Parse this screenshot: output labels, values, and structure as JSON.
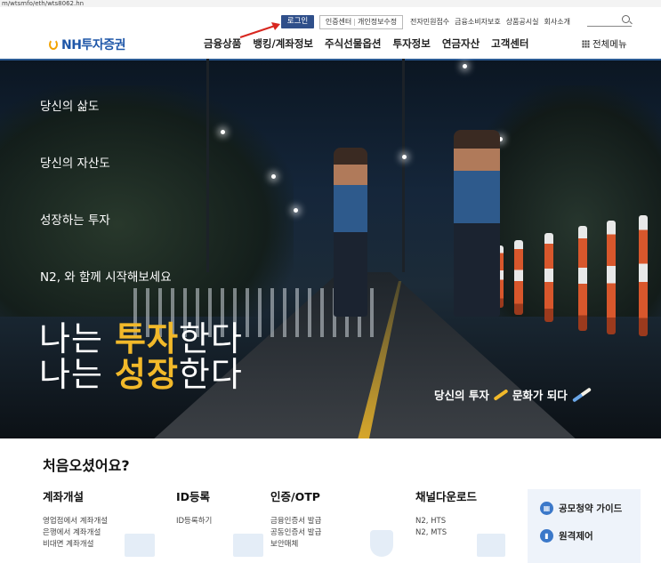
{
  "browser": {
    "url_fragment": "m/wtsmfo/eth/wts8062.hn"
  },
  "utility": {
    "login": "로그인",
    "cert_center": "인증센터",
    "edit_info": "개인정보수정",
    "links": [
      "전자민원접수",
      "금융소비자보호",
      "상품공시실",
      "회사소개"
    ]
  },
  "brand": {
    "logo": "NH투자증권",
    "accent": "#f2b92a",
    "navy": "#1e56a8"
  },
  "gnb": [
    "금융상품",
    "뱅킹/계좌정보",
    "주식선물옵션",
    "투자정보",
    "연금자산",
    "고객센터"
  ],
  "all_menu": "전체메뉴",
  "hero": {
    "line1": "당신의 삶도",
    "line2": "당신의 자산도",
    "line3": "성장하는 투자",
    "line4": "N2, 와 함께 시작해보세요",
    "big1_pre": "나는 ",
    "big1_hl": "투자",
    "big1_post": "한다",
    "big2_pre": "나는 ",
    "big2_hl": "성장",
    "big2_post": "한다",
    "slogan_a": "당신의 투자",
    "slogan_b": "문화가 되다"
  },
  "welcome": "처음오셨어요?",
  "columns": [
    {
      "title": "계좌개설",
      "items": [
        "영업점에서 계좌개설",
        "은행에서 계좌개설",
        "비대면 계좌개설"
      ]
    },
    {
      "title": "ID등록",
      "items": [
        "ID등록하기"
      ]
    },
    {
      "title": "인증/OTP",
      "items": [
        "금융인증서 발급",
        "공동인증서 발급",
        "보안매체"
      ]
    },
    {
      "title": "채널다운로드",
      "items": [
        "N2, HTS",
        "N2, MTS"
      ]
    }
  ],
  "side": [
    "공모청약 가이드",
    "원격제어"
  ]
}
